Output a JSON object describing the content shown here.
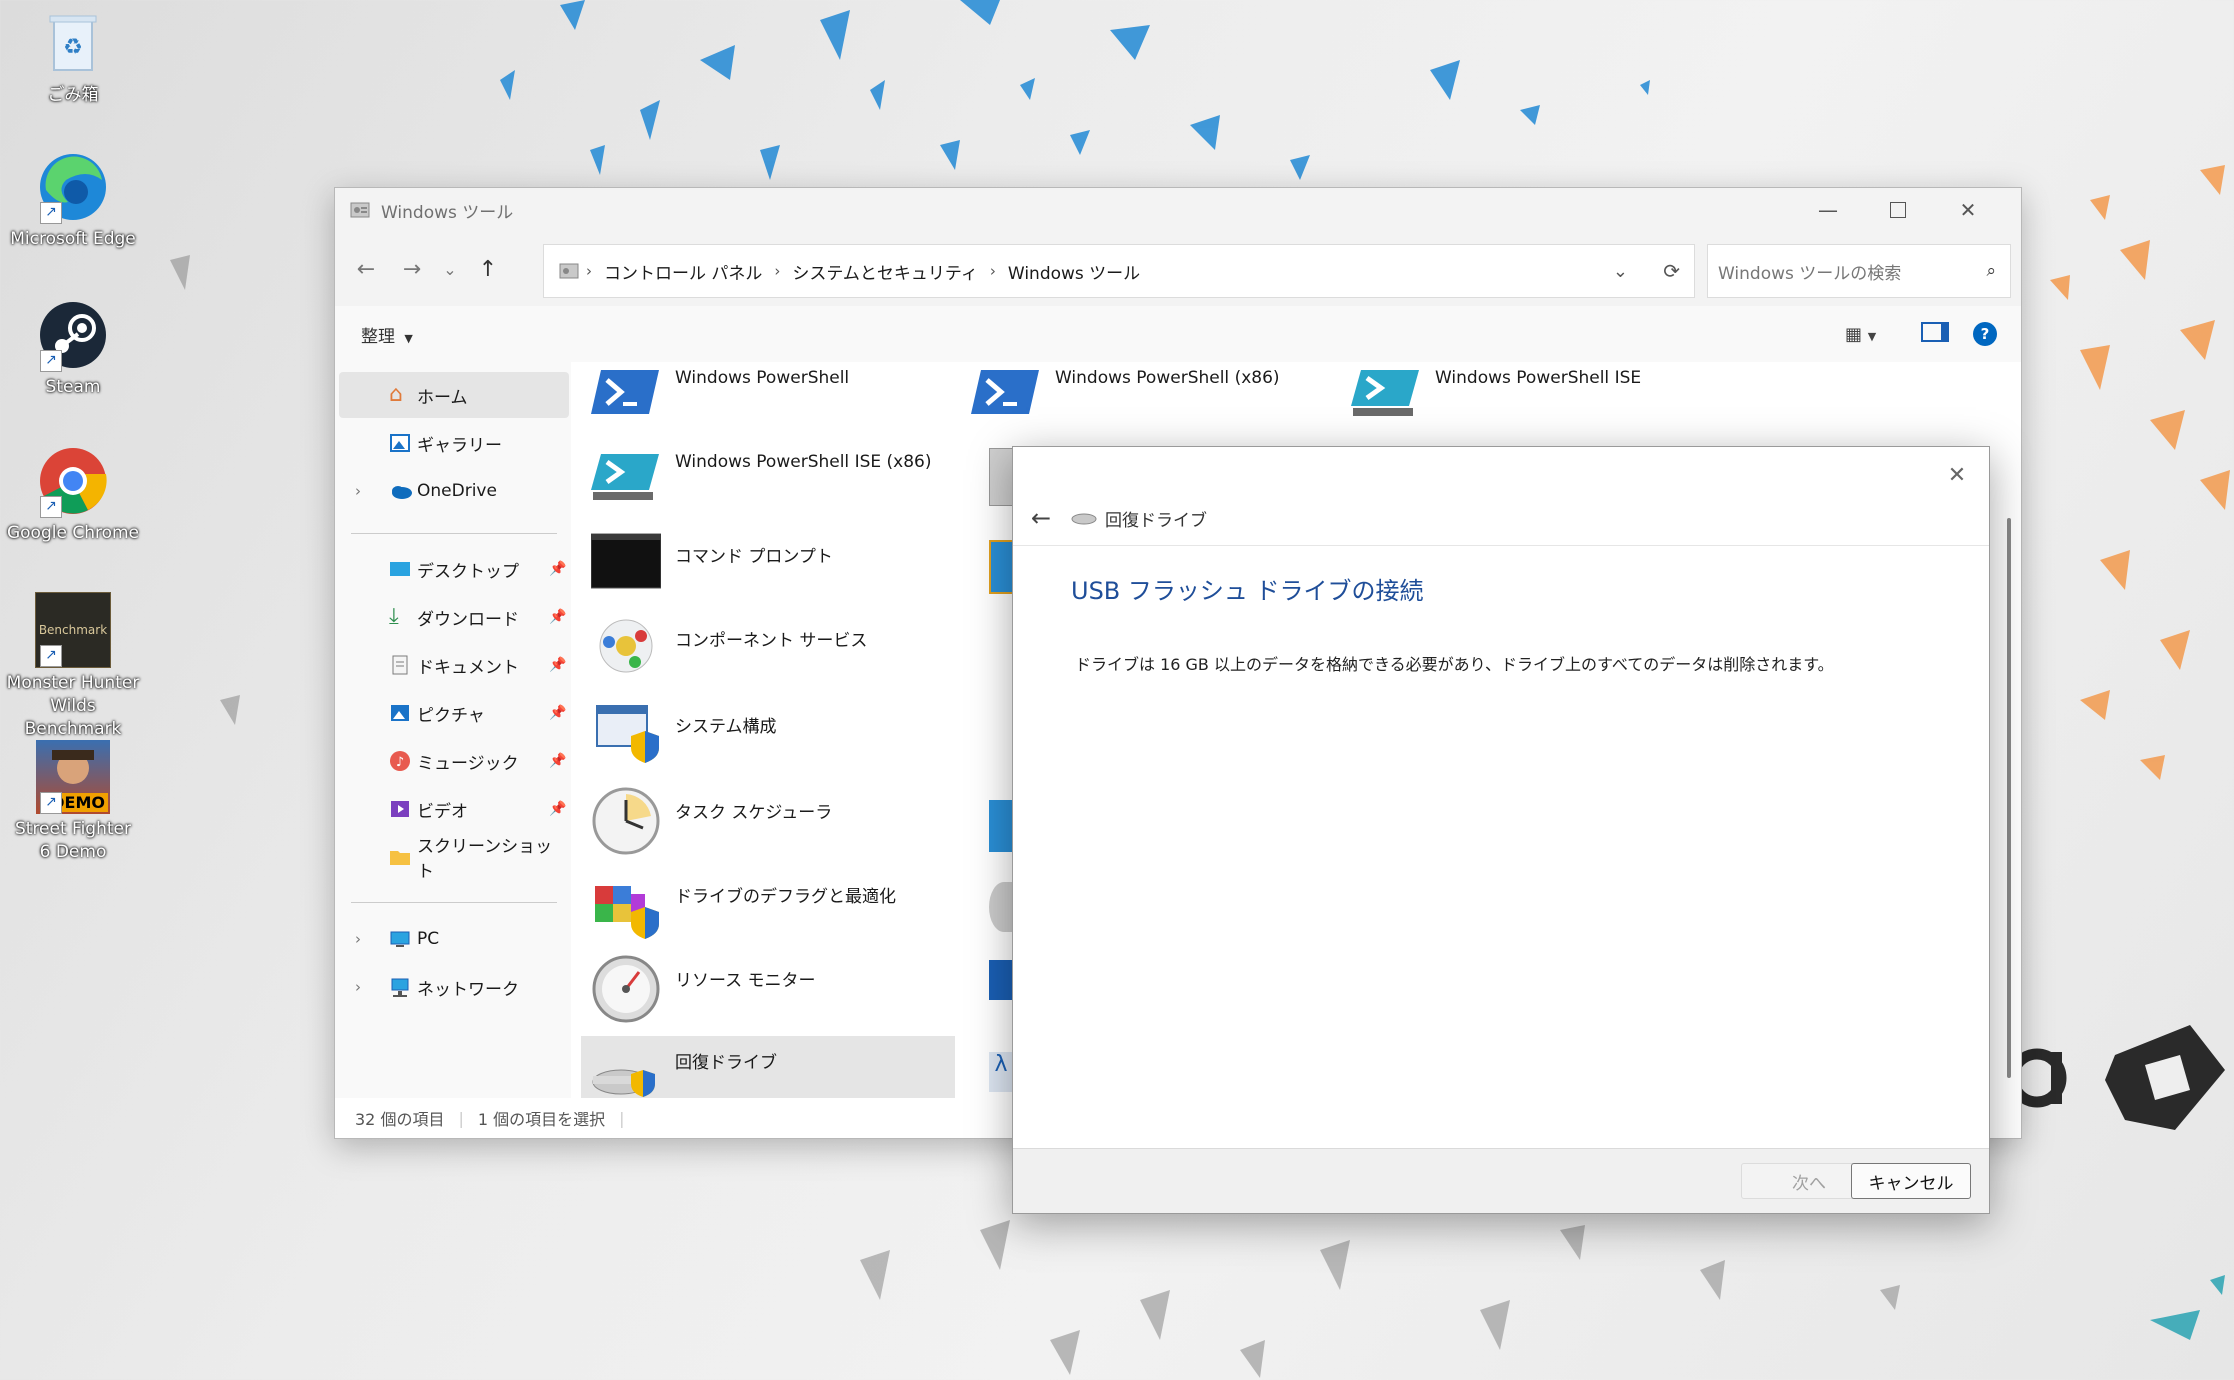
{
  "desktop": {
    "icons": [
      {
        "label": "ごみ箱",
        "icon": "recycle-bin-icon"
      },
      {
        "label": "Microsoft Edge",
        "icon": "edge-icon"
      },
      {
        "label": "Steam",
        "icon": "steam-icon"
      },
      {
        "label": "Google Chrome",
        "icon": "chrome-icon"
      },
      {
        "label": "Monster Hunter Wilds Benchmark",
        "badge": "Benchmark",
        "icon": "monster-hunter-icon"
      },
      {
        "label": "Street Fighter 6 Demo",
        "badge": "DEMO",
        "icon": "street-fighter-icon"
      }
    ]
  },
  "explorer": {
    "title": "Windows ツール",
    "breadcrumb": [
      "コントロール パネル",
      "システムとセキュリティ",
      "Windows ツール"
    ],
    "search_placeholder": "Windows ツールの検索",
    "organize_label": "整理",
    "sidebar": {
      "home": "ホーム",
      "gallery": "ギャラリー",
      "onedrive": "OneDrive",
      "desktop": "デスクトップ",
      "downloads": "ダウンロード",
      "documents": "ドキュメント",
      "pictures": "ピクチャ",
      "music": "ミュージック",
      "videos": "ビデオ",
      "screenshots": "スクリーンショット",
      "pc": "PC",
      "network": "ネットワーク"
    },
    "items": {
      "powershell": "Windows PowerShell",
      "powershell_x86": "Windows PowerShell (x86)",
      "powershell_ise": "Windows PowerShell ISE",
      "powershell_ise_x86": "Windows PowerShell ISE (x86)",
      "cmd": "コマンド プロンプト",
      "component_services": "コンポーネント サービス",
      "system_config": "システム構成",
      "task_scheduler": "タスク スケジューラ",
      "defrag": "ドライブのデフラグと最適化",
      "resource_monitor": "リソース モニター",
      "recovery_drive": "回復ドライブ"
    },
    "status": {
      "count": "32 個の項目",
      "selected": "1 個の項目を選択"
    }
  },
  "dialog": {
    "header_title": "回復ドライブ",
    "heading": "USB フラッシュ ドライブの接続",
    "body": "ドライブは 16 GB 以上のデータを格納できる必要があり、ドライブ上のすべてのデータは削除されます。",
    "next_label": "次へ",
    "cancel_label": "キャンセル"
  },
  "colors": {
    "accent": "#1f4e99",
    "selection": "#e5e5e5",
    "help": "#0067c0"
  }
}
